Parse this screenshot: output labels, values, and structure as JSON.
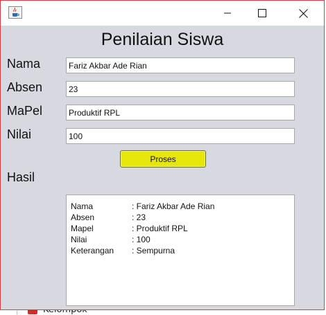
{
  "window": {
    "title": ""
  },
  "heading": "Penilaian Siswa",
  "form": {
    "nama_label": "Nama",
    "nama_value": "Fariz Akbar Ade Rian",
    "absen_label": "Absen",
    "absen_value": "23",
    "mapel_label": "MaPel",
    "mapel_value": "Produktif RPL",
    "nilai_label": "Nilai",
    "nilai_value": "100",
    "proses_label": "Proses",
    "hasil_label": "Hasil"
  },
  "result": {
    "rows": [
      {
        "key": "Nama",
        "value": ": Fariz Akbar Ade Rian"
      },
      {
        "key": "Absen",
        "value": ": 23"
      },
      {
        "key": "Mapel",
        "value": ": Produktif RPL"
      },
      {
        "key": "Nilai",
        "value": ": 100"
      },
      {
        "key": "Keterangan",
        "value": ": Sempurna"
      }
    ]
  },
  "background": {
    "partial_text": "Kelompok"
  },
  "colors": {
    "button": "#e6e60a",
    "window_bg": "#d6d9df",
    "border_accent": "#e03a3a"
  },
  "icons": {
    "app": "java-cup-icon",
    "minimize": "minimize-icon",
    "maximize": "maximize-icon",
    "close": "close-icon"
  }
}
